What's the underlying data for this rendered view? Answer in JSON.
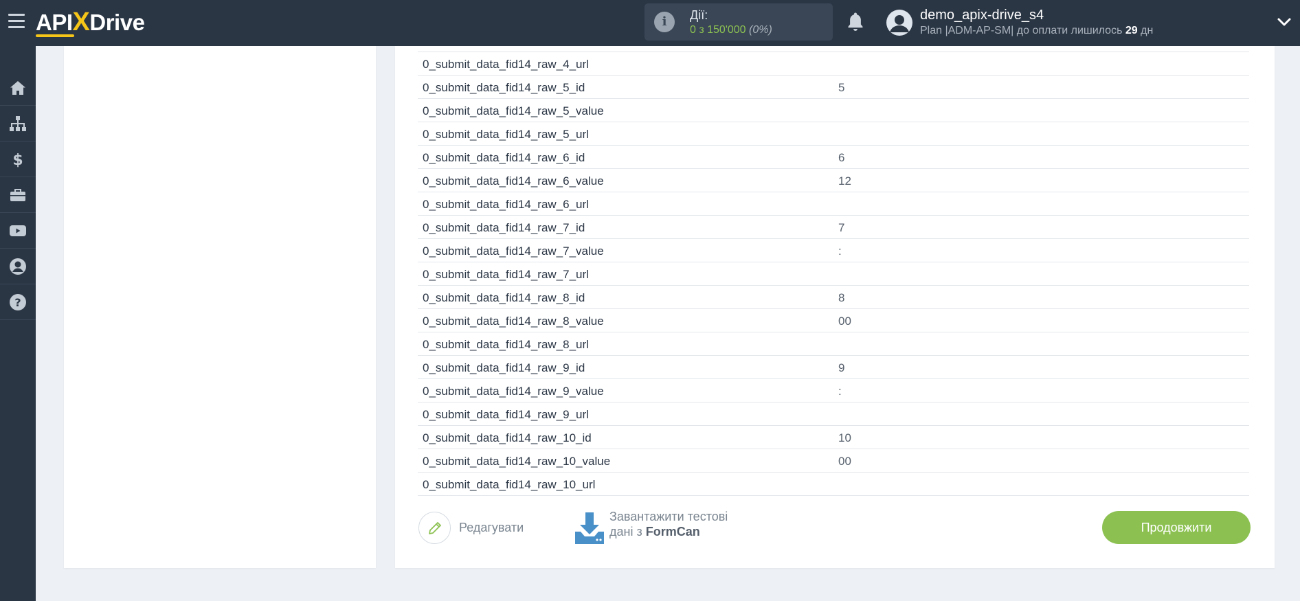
{
  "topbar": {
    "logo_api": "API",
    "logo_x": "X",
    "logo_drive": "Drive",
    "actions_label": "Дії:",
    "actions_value": "0 з 150'000",
    "actions_percent": "(0%)",
    "user_name": "demo_apix-drive_s4",
    "plan_prefix": "Plan |ADM-AP-SM| до оплати лишилось ",
    "plan_days": "29",
    "plan_suffix": " дн"
  },
  "sidebar": {
    "items": [
      {
        "icon": "home-icon"
      },
      {
        "icon": "sitemap-icon"
      },
      {
        "icon": "dollar-icon"
      },
      {
        "icon": "briefcase-icon"
      },
      {
        "icon": "youtube-icon"
      },
      {
        "icon": "user-icon"
      },
      {
        "icon": "help-icon"
      }
    ]
  },
  "table": {
    "rows": [
      {
        "key": "0_submit_data_fid14_raw_4_url",
        "value": ""
      },
      {
        "key": "0_submit_data_fid14_raw_5_id",
        "value": "5"
      },
      {
        "key": "0_submit_data_fid14_raw_5_value",
        "value": ""
      },
      {
        "key": "0_submit_data_fid14_raw_5_url",
        "value": ""
      },
      {
        "key": "0_submit_data_fid14_raw_6_id",
        "value": "6"
      },
      {
        "key": "0_submit_data_fid14_raw_6_value",
        "value": "12"
      },
      {
        "key": "0_submit_data_fid14_raw_6_url",
        "value": ""
      },
      {
        "key": "0_submit_data_fid14_raw_7_id",
        "value": "7"
      },
      {
        "key": "0_submit_data_fid14_raw_7_value",
        "value": ":"
      },
      {
        "key": "0_submit_data_fid14_raw_7_url",
        "value": ""
      },
      {
        "key": "0_submit_data_fid14_raw_8_id",
        "value": "8"
      },
      {
        "key": "0_submit_data_fid14_raw_8_value",
        "value": "00"
      },
      {
        "key": "0_submit_data_fid14_raw_8_url",
        "value": ""
      },
      {
        "key": "0_submit_data_fid14_raw_9_id",
        "value": "9"
      },
      {
        "key": "0_submit_data_fid14_raw_9_value",
        "value": ":"
      },
      {
        "key": "0_submit_data_fid14_raw_9_url",
        "value": ""
      },
      {
        "key": "0_submit_data_fid14_raw_10_id",
        "value": "10"
      },
      {
        "key": "0_submit_data_fid14_raw_10_value",
        "value": "00"
      },
      {
        "key": "0_submit_data_fid14_raw_10_url",
        "value": ""
      }
    ]
  },
  "buttons": {
    "edit_label": "Редагувати",
    "load_line1": "Завантажити тестові",
    "load_line2_prefix": "дані з ",
    "load_line2_source": "FormCan",
    "continue_label": "Продовжити"
  },
  "colors": {
    "topbar_bg": "#2b3645",
    "accent_green": "#8cc152",
    "logo_yellow": "#f5c518",
    "download_blue": "#4a90c8"
  }
}
